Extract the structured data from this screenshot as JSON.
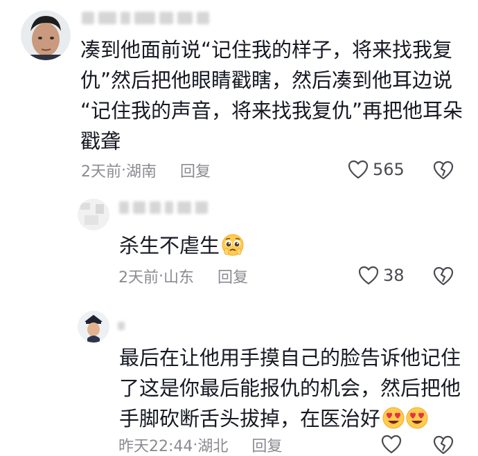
{
  "comments": [
    {
      "text_lines": [
        "凑到他面前说“记住我的样子，将来找我复",
        "仇”然后把他眼睛戳瞎，然后凑到他耳边说",
        "“记住我的声音，将来找我复仇”再把他耳朵",
        "戳聋"
      ],
      "time": "2天前",
      "location": "湖南",
      "reply_label": "回复",
      "like_count": "565"
    },
    {
      "text": "杀生不虐生",
      "emoji": "pleading-face",
      "time": "2天前",
      "location": "山东",
      "reply_label": "回复",
      "like_count": "38"
    },
    {
      "text_lines": [
        "最后在让他用手摸自己的脸告诉他记住",
        "了这是你最后能报仇的机会，然后把他",
        "手脚砍断舌头拔掉，在医治好"
      ],
      "emoji": "heart-eyes-face",
      "time": "昨天22:44",
      "location": "湖北",
      "reply_label": "回复",
      "like_count": ""
    }
  ],
  "separator": " · ",
  "colors": {
    "text": "#161823",
    "meta": "#8a8b91",
    "like": "#4a4b52"
  }
}
